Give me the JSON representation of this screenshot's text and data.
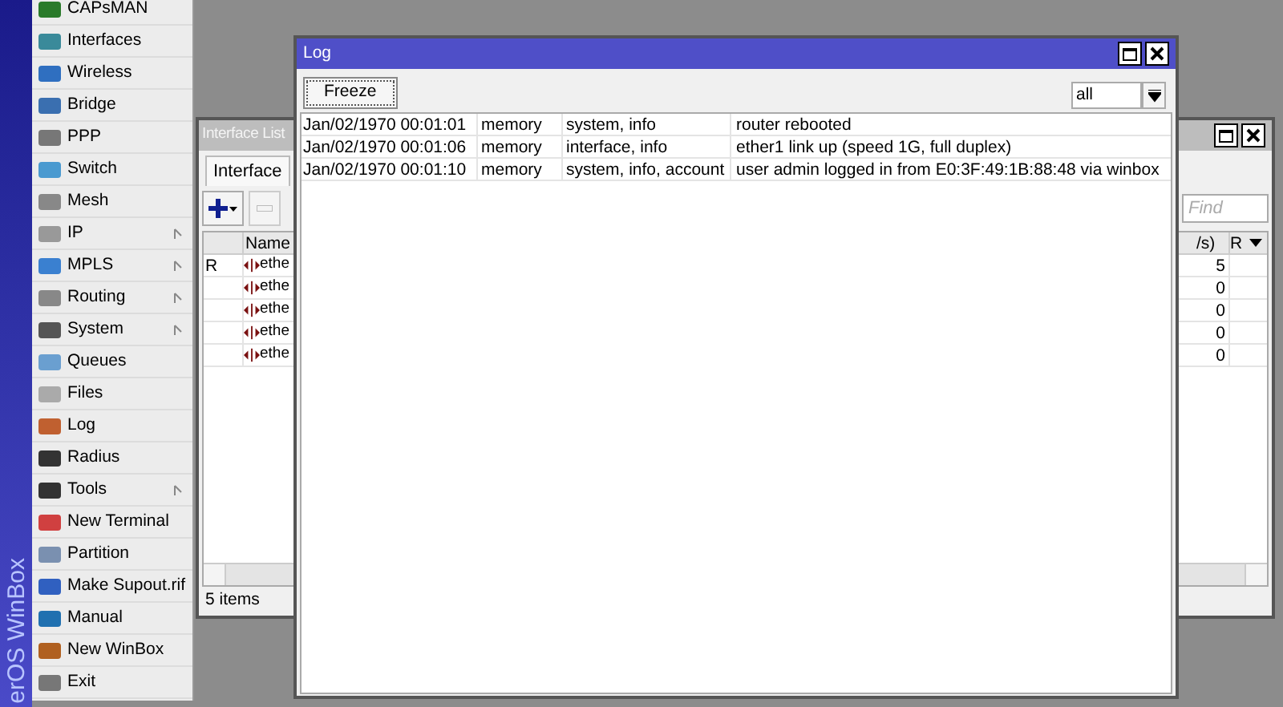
{
  "sidebar": {
    "brand": "erOS WinBox",
    "items": [
      {
        "label": "CAPsMAN",
        "submenu": false
      },
      {
        "label": "Interfaces",
        "submenu": false
      },
      {
        "label": "Wireless",
        "submenu": false
      },
      {
        "label": "Bridge",
        "submenu": false
      },
      {
        "label": "PPP",
        "submenu": false
      },
      {
        "label": "Switch",
        "submenu": false
      },
      {
        "label": "Mesh",
        "submenu": false
      },
      {
        "label": "IP",
        "submenu": true
      },
      {
        "label": "MPLS",
        "submenu": true
      },
      {
        "label": "Routing",
        "submenu": true
      },
      {
        "label": "System",
        "submenu": true
      },
      {
        "label": "Queues",
        "submenu": false
      },
      {
        "label": "Files",
        "submenu": false
      },
      {
        "label": "Log",
        "submenu": false
      },
      {
        "label": "Radius",
        "submenu": false
      },
      {
        "label": "Tools",
        "submenu": true
      },
      {
        "label": "New Terminal",
        "submenu": false
      },
      {
        "label": "Partition",
        "submenu": false
      },
      {
        "label": "Make Supout.rif",
        "submenu": false
      },
      {
        "label": "Manual",
        "submenu": false
      },
      {
        "label": "New WinBox",
        "submenu": false
      },
      {
        "label": "Exit",
        "submenu": false
      }
    ]
  },
  "interface_list": {
    "title": "Interface List",
    "tabs": [
      {
        "label": "Interface",
        "selected": true
      }
    ],
    "find": {
      "placeholder": "Find"
    },
    "columns": [
      "Name",
      "/s)",
      "R"
    ],
    "rows": [
      {
        "flag": "R",
        "name": "ethe",
        "value": "5"
      },
      {
        "flag": "",
        "name": "ethe",
        "value": "0"
      },
      {
        "flag": "",
        "name": "ethe",
        "value": "0"
      },
      {
        "flag": "",
        "name": "ethe",
        "value": "0"
      },
      {
        "flag": "",
        "name": "ethe",
        "value": "0"
      }
    ],
    "status": "5 items"
  },
  "log": {
    "title": "Log",
    "freeze_button": "Freeze",
    "filter": "all",
    "rows": [
      {
        "time": "Jan/02/1970 00:01:01",
        "buffer": "memory",
        "topics": "system, info",
        "message": "router rebooted"
      },
      {
        "time": "Jan/02/1970 00:01:06",
        "buffer": "memory",
        "topics": "interface, info",
        "message": "ether1 link up (speed 1G, full duplex)"
      },
      {
        "time": "Jan/02/1970 00:01:10",
        "buffer": "memory",
        "topics": "system, info, account",
        "message": "user admin logged in from E0:3F:49:1B:88:48 via winbox"
      }
    ]
  }
}
